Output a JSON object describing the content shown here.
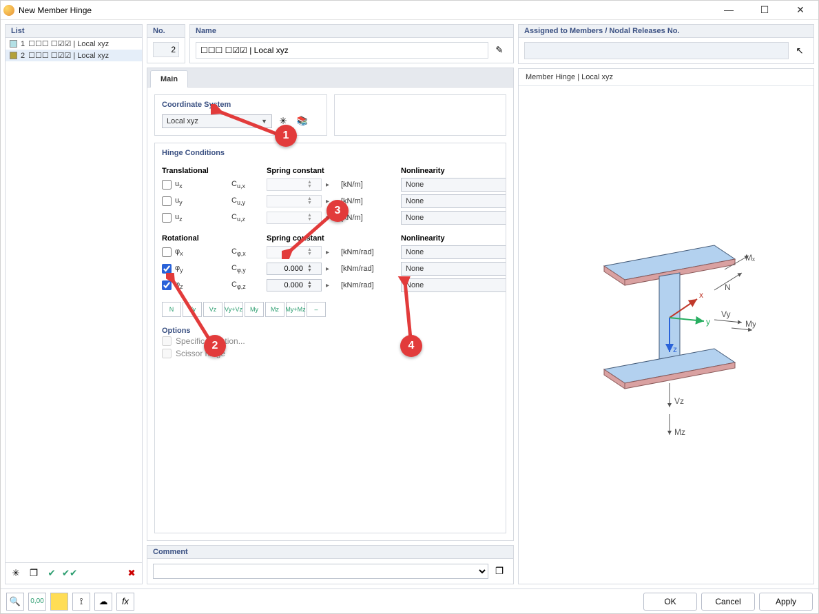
{
  "window": {
    "title": "New Member Hinge"
  },
  "list": {
    "header": "List",
    "items": [
      {
        "num": "1",
        "symbols": "☐☐☐ ☐☑☑ | Local xyz",
        "swatch": "#b3e0e5"
      },
      {
        "num": "2",
        "symbols": "☐☐☐ ☐☑☑ | Local xyz",
        "swatch": "#b3a13a",
        "selected": true
      }
    ]
  },
  "no": {
    "label": "No.",
    "value": "2"
  },
  "name": {
    "label": "Name",
    "value": "☐☐☐ ☐☑☑ | Local xyz"
  },
  "assigned": {
    "label": "Assigned to Members / Nodal Releases No.",
    "value": ""
  },
  "tabs": {
    "main": "Main"
  },
  "coord": {
    "title": "Coordinate System",
    "value": "Local xyz"
  },
  "hinge": {
    "title": "Hinge Conditions",
    "translational_label": "Translational",
    "spring_label": "Spring constant",
    "nonlin_label": "Nonlinearity",
    "rotational_label": "Rotational",
    "rows_trans": [
      {
        "id": "ux",
        "sym": "u",
        "sub": "x",
        "csym": "C",
        "csub": "u,x",
        "unit": "[kN/m]",
        "nonlin": "None",
        "checked": false
      },
      {
        "id": "uy",
        "sym": "u",
        "sub": "y",
        "csym": "C",
        "csub": "u,y",
        "unit": "[kN/m]",
        "nonlin": "None",
        "checked": false
      },
      {
        "id": "uz",
        "sym": "u",
        "sub": "z",
        "csym": "C",
        "csub": "u,z",
        "unit": "[kN/m]",
        "nonlin": "None",
        "checked": false
      }
    ],
    "rows_rot": [
      {
        "id": "phix",
        "sym": "φ",
        "sub": "x",
        "csym": "C",
        "csub": "φ,x",
        "unit": "[kNm/rad]",
        "nonlin": "None",
        "checked": false
      },
      {
        "id": "phiy",
        "sym": "φ",
        "sub": "y",
        "csym": "C",
        "csub": "φ,y",
        "unit": "[kNm/rad]",
        "nonlin": "None",
        "checked": true,
        "value": "0.000"
      },
      {
        "id": "phiz",
        "sym": "φ",
        "sub": "z",
        "csym": "C",
        "csub": "φ,z",
        "unit": "[kNm/rad]",
        "nonlin": "None",
        "checked": true,
        "value": "0.000"
      }
    ],
    "presets": [
      "N",
      "Vy",
      "Vz",
      "Vy+Vz",
      "My",
      "Mz",
      "My+Mz",
      "–"
    ]
  },
  "options": {
    "title": "Options",
    "specific": "Specific direction...",
    "scissor": "Scissor hinge"
  },
  "preview": {
    "title": "Member Hinge | Local xyz"
  },
  "comment": {
    "title": "Comment"
  },
  "buttons": {
    "ok": "OK",
    "cancel": "Cancel",
    "apply": "Apply"
  },
  "annotations": {
    "a1": "1",
    "a2": "2",
    "a3": "3",
    "a4": "4"
  },
  "axes": {
    "x": "x",
    "y": "y",
    "z": "z",
    "N": "N",
    "Mx": "Mₓ",
    "My": "My",
    "Mz": "Mz",
    "Vy": "Vy",
    "Vz": "Vz"
  }
}
